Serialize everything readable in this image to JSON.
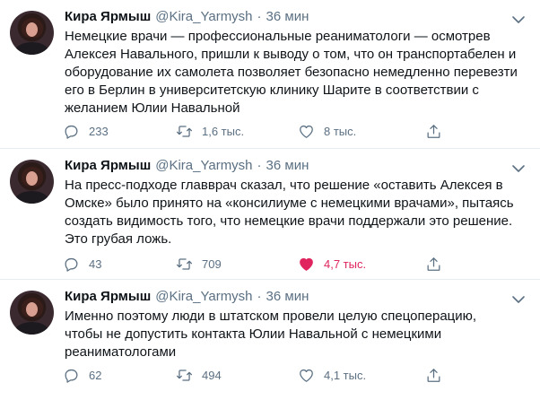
{
  "tweets": [
    {
      "name": "Кира Ярмыш",
      "handle": "@Kira_Yarmysh",
      "separator": "·",
      "time": "36 мин",
      "text": "Немецкие врачи — профессиональные реаниматологи — осмотрев\nАлексея Навального, пришли к выводу о том, что он транспортабелен и\nоборудование их самолета позволяет безопасно немедленно перевезти\nего в Берлин в университетскую клинику Шарите в соответствии с\nжеланием Юлии Навальной",
      "replies": "233",
      "retweets": "1,6 тыс.",
      "likes": "8 тыс.",
      "liked": false
    },
    {
      "name": "Кира Ярмыш",
      "handle": "@Kira_Yarmysh",
      "separator": "·",
      "time": "36 мин",
      "text": "На пресс-подходе главврач сказал, что решение «оставить Алексея в\nОмске» было принято на «консилиуме с немецкими врачами», пытаясь\nсоздать видимость того, что немецкие врачи поддержали это решение.\nЭто грубая ложь.",
      "replies": "43",
      "retweets": "709",
      "likes": "4,7 тыс.",
      "liked": true
    },
    {
      "name": "Кира Ярмыш",
      "handle": "@Kira_Yarmysh",
      "separator": "·",
      "time": "36 мин",
      "text": "Именно поэтому люди в штатском провели целую спецоперацию,\nчтобы не допустить контакта Юлии Навальной с немецкими\nреаниматологами",
      "replies": "62",
      "retweets": "494",
      "likes": "4,1 тыс.",
      "liked": false
    }
  ],
  "colors": {
    "text": "#0f1419",
    "secondary": "#5b7083",
    "liked": "#e0245e",
    "divider": "#e6ecf0"
  },
  "icons": {
    "reply": "speech-bubble",
    "retweet": "retweet-arrows",
    "like": "heart",
    "share": "upload-arrow",
    "more": "chevron-down"
  }
}
